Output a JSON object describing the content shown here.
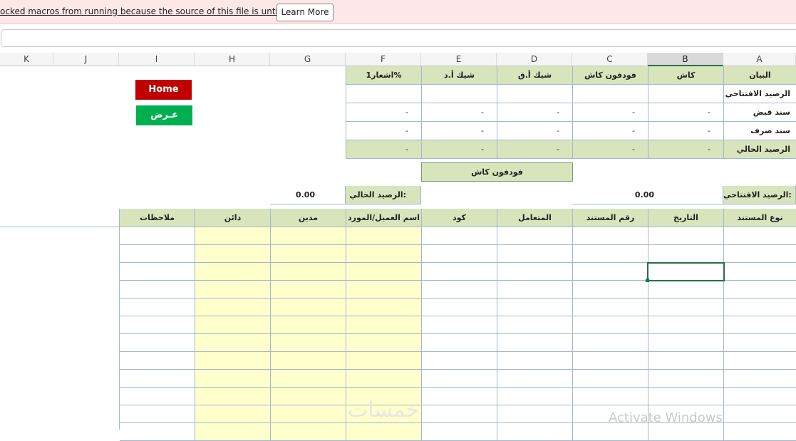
{
  "message_bar": {
    "text": "ocked macros from running because the source of this file is untrusted.",
    "button": "Learn More"
  },
  "column_headers": [
    "A",
    "B",
    "C",
    "D",
    "E",
    "F",
    "G",
    "H",
    "I",
    "J",
    "K"
  ],
  "summary_table": {
    "headers": [
      "البيان",
      "كاش",
      "فودفون كاش",
      "شيك أ.ق",
      "شيك أ.د",
      "اشعار1%"
    ],
    "rows": [
      {
        "label": "الرصيد الافتتاحي",
        "values": [
          "",
          "",
          "",
          "",
          ""
        ]
      },
      {
        "label": "سند قبض",
        "values": [
          "-",
          "-",
          "-",
          "-",
          "-"
        ]
      },
      {
        "label": "سند صرف",
        "values": [
          "-",
          "-",
          "-",
          "-",
          "-"
        ]
      },
      {
        "label": "الرصيد الحالي",
        "values": [
          "-",
          "-",
          "-",
          "-",
          "-"
        ]
      }
    ]
  },
  "buttons": {
    "home": "Home",
    "home_color": "#c00000",
    "view": "عـرض",
    "view_color": "#00b050"
  },
  "ledger": {
    "title": "فودفون كاش",
    "opening_label": "الرصيد الافتتاحي:",
    "opening_value": "0.00",
    "current_label": "الرصيد الحالي:",
    "current_value": "0.00",
    "headers": [
      "نوع المستند",
      "التاريخ",
      "رقم المستند",
      "المتعامل",
      "كود",
      "اسم العميل/المورد",
      "مدين",
      "دائن",
      "ملاحظات"
    ]
  },
  "colors": {
    "header_green": "#d8e4bc",
    "input_yellow": "#ffffcc",
    "grid_blue": "#a3b7d0",
    "excel_green": "#217346"
  },
  "watermark": {
    "activate": "Activate Windows",
    "brand": "خمسات"
  }
}
